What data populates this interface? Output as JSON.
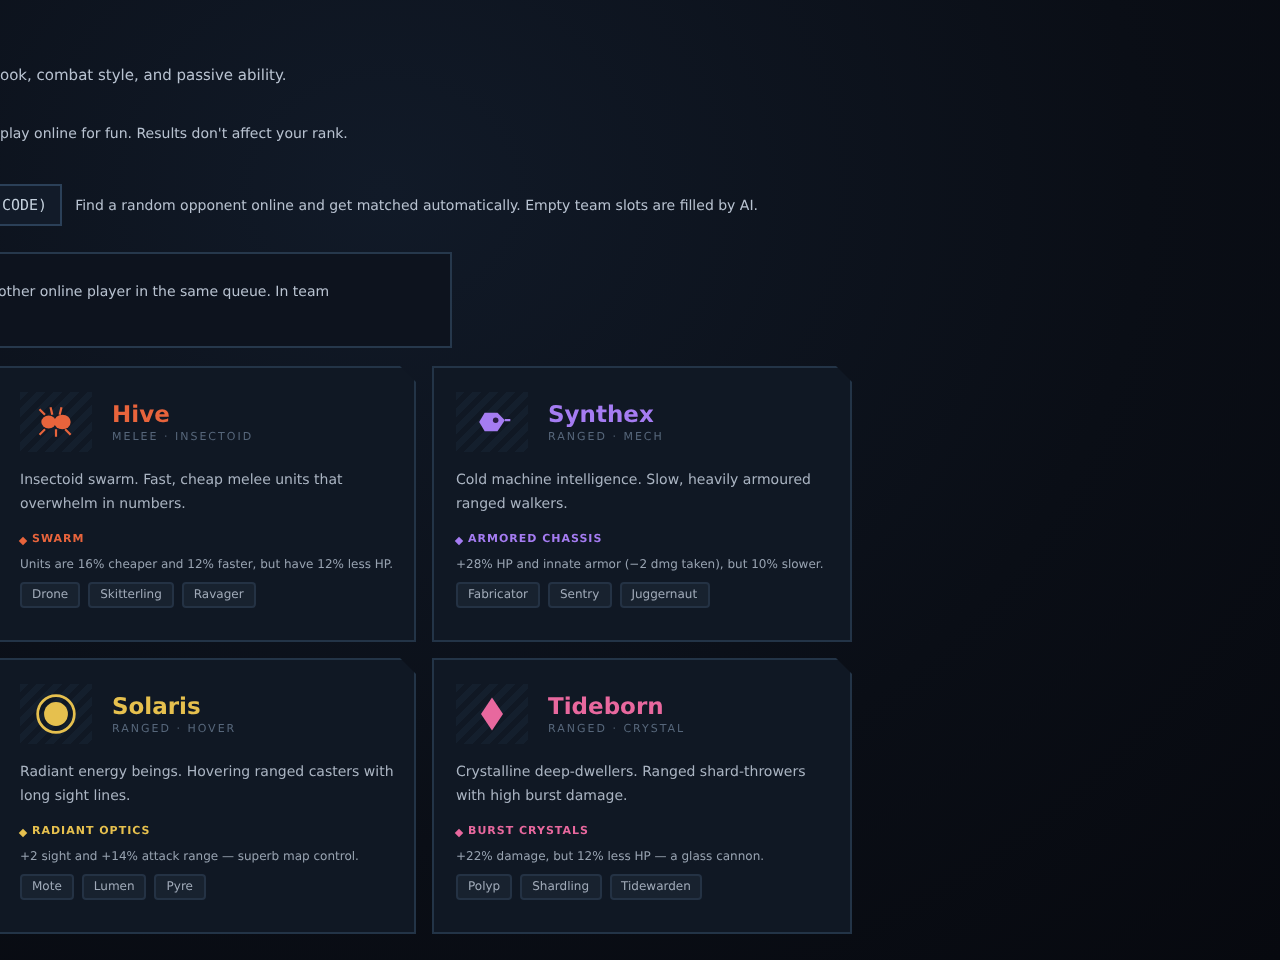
{
  "intro_lines": [
    "ook, combat style, and passive ability.",
    "play online for fun. Results don't affect your rank."
  ],
  "mode_row": {
    "button_label": "CODE)",
    "description": "Find a random opponent online and get matched automatically. Empty team slots are filled by AI."
  },
  "mode_box": {
    "text": "other online player in the same queue. In team"
  },
  "factions": [
    {
      "name": "Hive",
      "kind": "bug",
      "color": "#e8643c",
      "roles": "MELEE · INSECTOID",
      "description": "Insectoid swarm. Fast, cheap melee units that overwhelm in numbers.",
      "trait": "SWARM",
      "trait_text": "Units are 16% cheaper and 12% faster, but have 12% less HP.",
      "units": [
        "Drone",
        "Skitterling",
        "Ravager"
      ]
    },
    {
      "name": "Synthex",
      "kind": "drone",
      "color": "#a57cf2",
      "roles": "RANGED · MECH",
      "description": "Cold machine intelligence. Slow, heavily armoured ranged walkers.",
      "trait": "ARMORED CHASSIS",
      "trait_text": "+28% HP and innate armor (−2 dmg taken), but 10% slower.",
      "units": [
        "Fabricator",
        "Sentry",
        "Juggernaut"
      ]
    },
    {
      "name": "Solaris",
      "kind": "orb",
      "color": "#e6c04e",
      "roles": "RANGED · HOVER",
      "description": "Radiant energy beings. Hovering ranged casters with long sight lines.",
      "trait": "RADIANT OPTICS",
      "trait_text": "+2 sight and +14% attack range — superb map control.",
      "units": [
        "Mote",
        "Lumen",
        "Pyre"
      ]
    },
    {
      "name": "Tideborn",
      "kind": "crystal",
      "color": "#e8689e",
      "roles": "RANGED · CRYSTAL",
      "description": "Crystalline deep-dwellers. Ranged shard-throwers with high burst damage.",
      "trait": "BURST CRYSTALS",
      "trait_text": "+22% damage, but 12% less HP — a glass cannon.",
      "units": [
        "Polyp",
        "Shardling",
        "Tidewarden"
      ]
    }
  ]
}
